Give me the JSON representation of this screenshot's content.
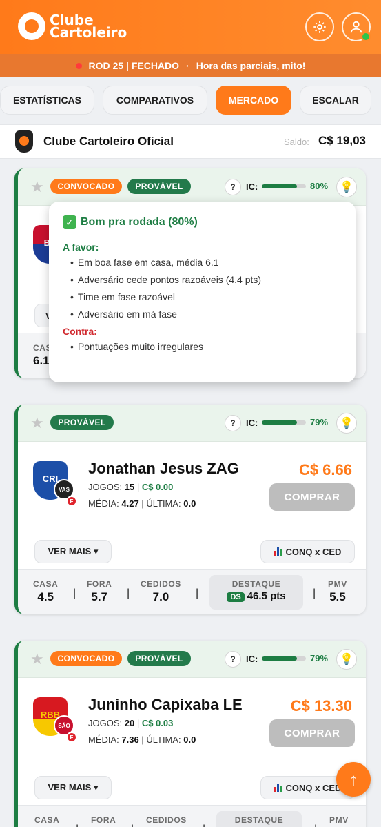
{
  "header": {
    "logo_line1": "Clube",
    "logo_line2": "Cartoleiro",
    "settings_icon": "gear-icon",
    "user_icon": "user-icon"
  },
  "status_strip": {
    "round": "ROD 25 | FECHADO",
    "separator": "·",
    "message": "Hora das parciais, mito!"
  },
  "nav_tabs": [
    {
      "label": "ESTATÍSTICAS",
      "active": false
    },
    {
      "label": "COMPARATIVOS",
      "active": false
    },
    {
      "label": "MERCADO",
      "active": true
    },
    {
      "label": "ESCALAR",
      "active": false
    }
  ],
  "club": {
    "name": "Clube Cartoleiro Oficial",
    "saldo_label": "Saldo:",
    "saldo_value": "C$ 19,03"
  },
  "tooltip": {
    "title": "Bom pra rodada (80%)",
    "favor_label": "A favor:",
    "favor_items": [
      "Em boa fase em casa, média 6.1",
      "Adversário cede pontos razoáveis (4.4 pts)",
      "Time em fase razoável",
      "Adversário em má fase"
    ],
    "contra_label": "Contra:",
    "contra_items": [
      "Pontuações muito irregulares"
    ]
  },
  "cards": [
    {
      "tags": [
        "CONVOCADO",
        "PROVÁVEL"
      ],
      "help": "?",
      "ic_label": "IC:",
      "ic_pct": "80%",
      "ic_value": 0.8,
      "team_abbr": "BA",
      "more_label": "VE",
      "stats_casa_label": "CASA",
      "stats_casa_value": "6.1"
    },
    {
      "tags": [
        "PROVÁVEL"
      ],
      "help": "?",
      "ic_label": "IC:",
      "ic_pct": "79%",
      "ic_value": 0.79,
      "team_abbr": "CRI",
      "opp_abbr": "VAS",
      "f_tag": "F",
      "name": "Jonathan Jesus ZAG",
      "jogos_label": "JOGOS:",
      "jogos": "15",
      "delta": "C$ 0.00",
      "media_label": "MÉDIA:",
      "media": "4.27",
      "ultima_label": "ÚLTIMA:",
      "ultima": "0.0",
      "price": "C$ 6.66",
      "buy_label": "COMPRAR",
      "more_label": "VER MAIS ▾",
      "conq_label": "CONQ x CED",
      "stats": [
        {
          "k": "CASA",
          "v": "4.5"
        },
        {
          "k": "FORA",
          "v": "5.7"
        },
        {
          "k": "CEDIDOS",
          "v": "7.0"
        },
        {
          "k": "DESTAQUE",
          "v": "46.5 pts",
          "badge": "DS"
        },
        {
          "k": "PMV",
          "v": "5.5"
        }
      ]
    },
    {
      "tags": [
        "CONVOCADO",
        "PROVÁVEL"
      ],
      "help": "?",
      "ic_label": "IC:",
      "ic_pct": "79%",
      "ic_value": 0.79,
      "team_abbr": "RBB",
      "opp_abbr": "SÃO",
      "f_tag": "F",
      "name": "Juninho Capixaba LE",
      "jogos_label": "JOGOS:",
      "jogos": "20",
      "delta": "C$ 0.03",
      "media_label": "MÉDIA:",
      "media": "7.36",
      "ultima_label": "ÚLTIMA:",
      "ultima": "0.0",
      "price": "C$ 13.30",
      "buy_label": "COMPRAR",
      "more_label": "VER MAIS ▾",
      "conq_label": "CONQ x CED",
      "stats": [
        {
          "k": "CASA"
        },
        {
          "k": "FORA"
        },
        {
          "k": "CEDIDOS"
        },
        {
          "k": "DESTAQUE"
        },
        {
          "k": "PMV"
        }
      ]
    }
  ],
  "fab": {
    "icon": "scroll-top-icon",
    "glyph": "↑"
  },
  "colors": {
    "brand_orange": "#ff7a1a",
    "green": "#1d7d43",
    "red": "#d0272d"
  }
}
